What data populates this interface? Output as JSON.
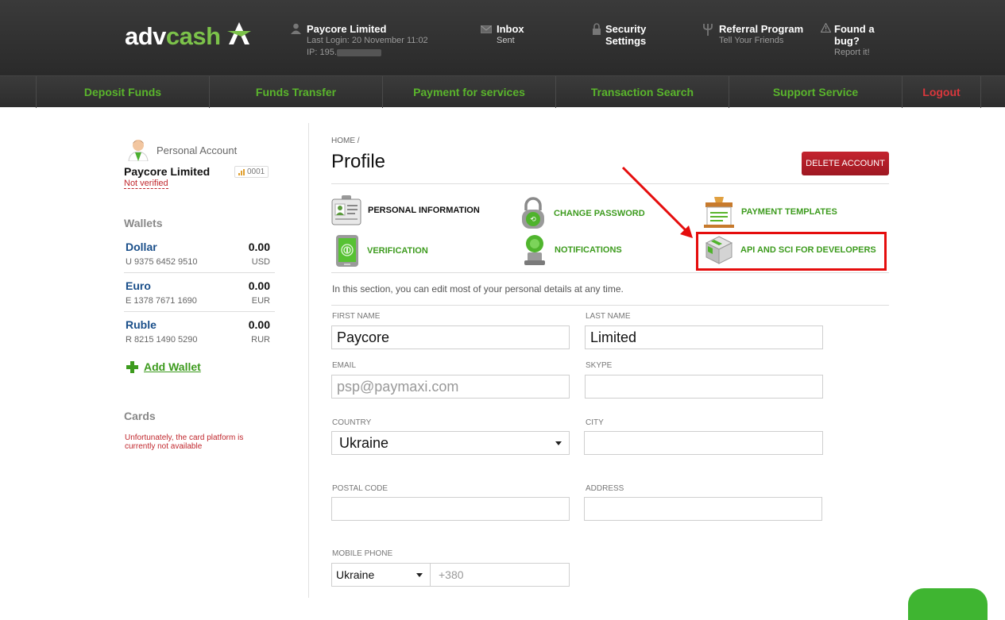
{
  "header": {
    "logo": {
      "part1": "adv",
      "part2": "cash"
    },
    "account": {
      "name": "Paycore Limited",
      "last_login": "Last Login: 20 November 11:02",
      "ip": "IP: 195."
    },
    "inbox": {
      "title": "Inbox",
      "sub": "Sent"
    },
    "security": {
      "title1": "Security",
      "title2": "Settings"
    },
    "referral": {
      "title": "Referral Program",
      "sub": "Tell Your Friends"
    },
    "bug": {
      "title1": "Found a",
      "title2": "bug?",
      "sub": "Report it!"
    }
  },
  "nav": [
    {
      "label": "Deposit Funds"
    },
    {
      "label": "Funds Transfer"
    },
    {
      "label": "Payment for services"
    },
    {
      "label": "Transaction Search"
    },
    {
      "label": "Support Service"
    },
    {
      "label": "Logout"
    }
  ],
  "sidebar": {
    "account_label": "Personal Account",
    "account_name": "Paycore Limited",
    "badge": "0001",
    "status": "Not verified",
    "wallets_title": "Wallets",
    "wallets": [
      {
        "name": "Dollar",
        "number": "U 9375 6452 9510",
        "balance": "0.00",
        "currency": "USD"
      },
      {
        "name": "Euro",
        "number": "E 1378 7671 1690",
        "balance": "0.00",
        "currency": "EUR"
      },
      {
        "name": "Ruble",
        "number": "R 8215 1490 5290",
        "balance": "0.00",
        "currency": "RUR"
      }
    ],
    "add_wallet": "Add Wallet",
    "cards_title": "Cards",
    "cards_message": "Unfortunately, the card platform is currently not available"
  },
  "main": {
    "breadcrumb": "HOME /",
    "title": "Profile",
    "delete_button": "DELETE ACCOUNT",
    "menu": [
      {
        "label": "PERSONAL INFORMATION",
        "icon": "id-card-icon"
      },
      {
        "label": "CHANGE PASSWORD",
        "icon": "padlock-icon"
      },
      {
        "label": "PAYMENT TEMPLATES",
        "icon": "templates-box-icon"
      },
      {
        "label": "VERIFICATION",
        "icon": "fingerprint-phone-icon"
      },
      {
        "label": "NOTIFICATIONS",
        "icon": "notification-bell-icon"
      },
      {
        "label": "API AND SCI FOR DEVELOPERS",
        "icon": "cube-icon"
      }
    ],
    "intro": "In this section, you can edit most of your personal details at any time.",
    "form": {
      "first_name_label": "FIRST NAME",
      "first_name": "Paycore",
      "last_name_label": "LAST NAME",
      "last_name": "Limited",
      "email_label": "EMAIL",
      "email": "psp@paymaxi.com",
      "skype_label": "SKYPE",
      "skype": "",
      "country_label": "COUNTRY",
      "country": "Ukraine",
      "city_label": "CITY",
      "city": "",
      "postal_label": "POSTAL CODE",
      "postal": "",
      "address_label": "ADDRESS",
      "address": "",
      "phone_label": "MOBILE PHONE",
      "phone_country": "Ukraine",
      "phone_prefix": "+380"
    }
  },
  "colors": {
    "accent_green": "#5ab52c",
    "logout_red": "#d9373c",
    "delete_red": "#b01e28",
    "highlight_red": "#e50d0d"
  }
}
